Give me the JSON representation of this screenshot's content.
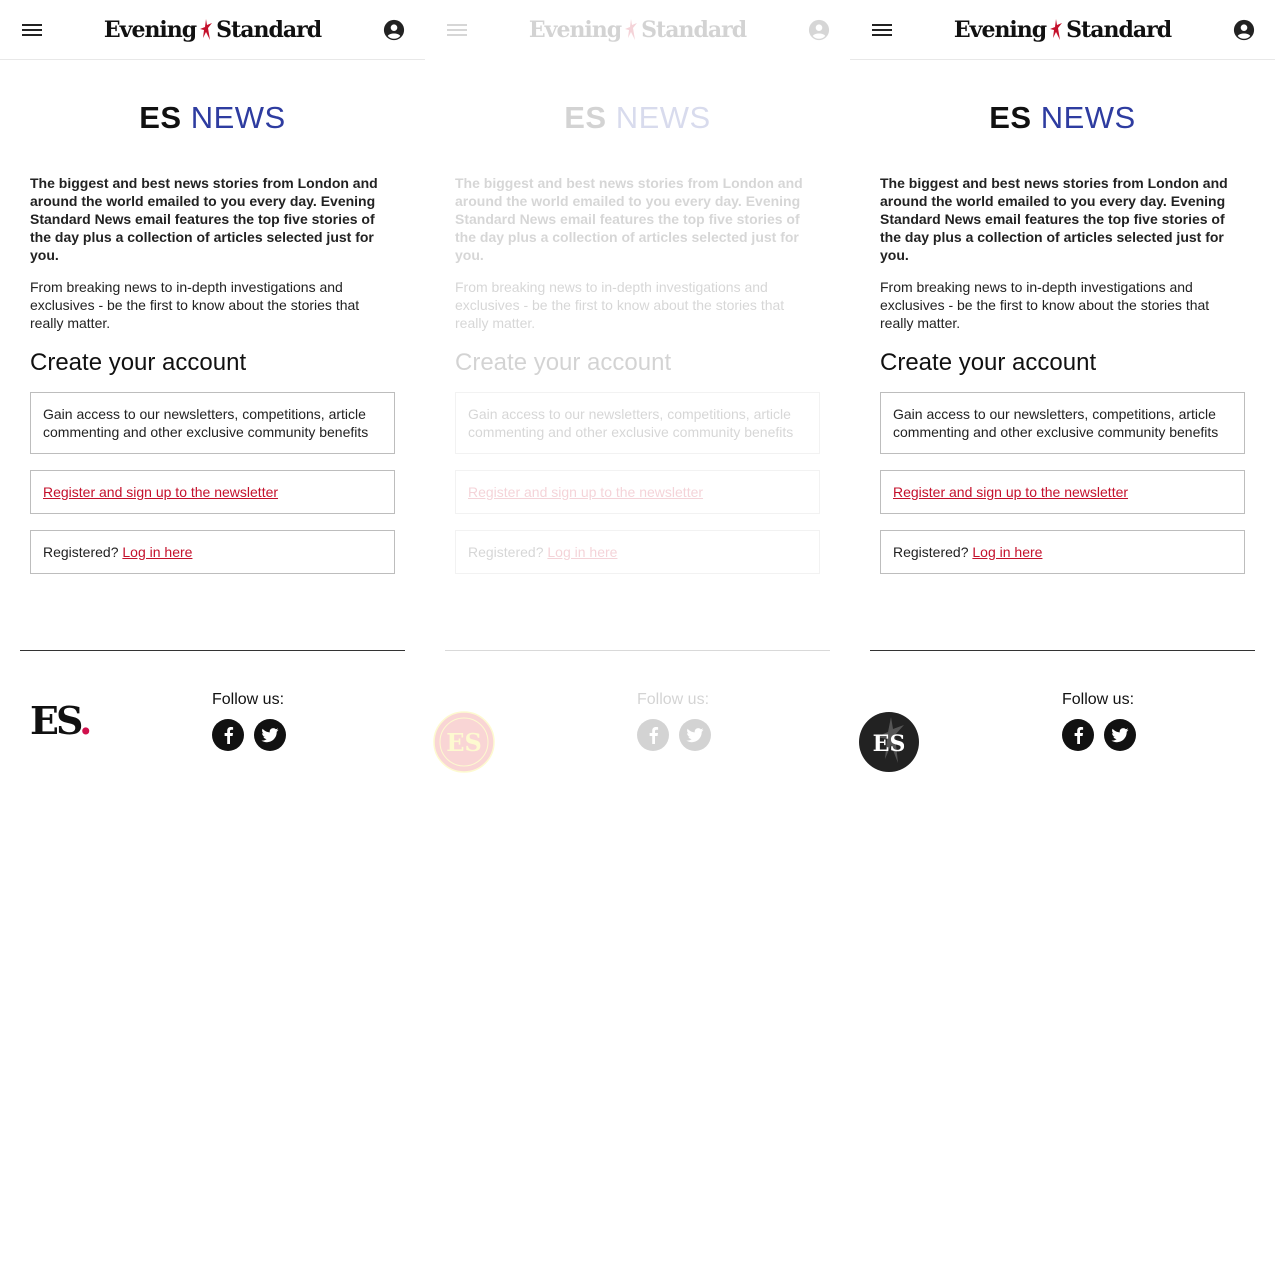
{
  "header": {
    "brand": "Evening Standard",
    "brand_left": "Evening",
    "brand_right": "Standard"
  },
  "hero": {
    "title_es": "ES",
    "title_news": "NEWS"
  },
  "intro": {
    "bold": "The biggest and best news stories from London and around the world emailed to you every day. Evening Standard News email features the top five stories of the day plus a collection of articles selected just for you.",
    "regular": "From breaking news to in-depth investigations and exclusives - be the first to know about the stories that really matter."
  },
  "account": {
    "heading": "Create your account",
    "benefits": "Gain access to our newsletters, competitions, article commenting and other exclusive community benefits",
    "register_link": "Register and sign up to the newsletter",
    "registered_prefix": "Registered?",
    "login_link": "Log in here"
  },
  "footer": {
    "follow_label": "Follow us:",
    "logo_text": "ES",
    "logo_dot": ".",
    "social": [
      "facebook-icon",
      "twitter-icon"
    ]
  },
  "colors": {
    "accent_blue": "#2e3ca0",
    "link_red": "#c4102b",
    "logo_dot": "#d0104c",
    "seal_red": "#e11b1b",
    "seal_yellow": "#f5e400"
  }
}
